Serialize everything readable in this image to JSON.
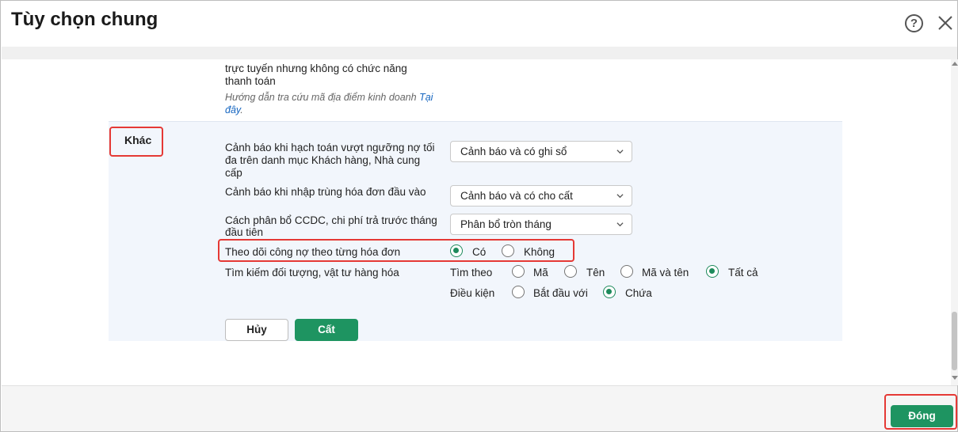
{
  "dialog": {
    "title": "Tùy chọn chung",
    "help_symbol": "?"
  },
  "top_section": {
    "text_line_1": "trực tuyến nhưng không có chức năng",
    "text_line_2": "thanh toán",
    "hint_text": "Hướng dẫn tra cứu mã địa điểm kinh doanh ",
    "hint_link_1": "Tại",
    "hint_link_2": "đây",
    "hint_end": "."
  },
  "khac": {
    "section_label": "Khác",
    "debt_warning": {
      "label_line_1": "Cảnh báo khi hạch toán vượt ngưỡng nợ tối",
      "label_line_2": "đa trên danh mục Khách hàng, Nhà cung",
      "label_line_3": "cấp",
      "value": "Cảnh báo và có ghi sổ"
    },
    "duplicate_invoice": {
      "label": "Cảnh báo khi nhập trùng hóa đơn đầu vào",
      "value": "Cảnh báo và có cho cất"
    },
    "ccdc_allocation": {
      "label_line_1": "Cách phân bổ CCDC, chi phí trả trước tháng",
      "label_line_2": "đầu tiên",
      "value": "Phân bổ tròn tháng"
    },
    "track_debt_by_invoice": {
      "label": "Theo dõi công nợ theo từng hóa đơn",
      "options": [
        "Có",
        "Không"
      ],
      "selected": "Có"
    },
    "search": {
      "label": "Tìm kiếm đối tượng, vật tư hàng hóa",
      "search_by_label": "Tìm theo",
      "search_by_options": [
        "Mã",
        "Tên",
        "Mã và tên",
        "Tất cả"
      ],
      "search_by_selected": "Tất cả",
      "condition_label": "Điều kiện",
      "condition_options": [
        "Bắt đầu với",
        "Chứa"
      ],
      "condition_selected": "Chứa"
    },
    "cancel_label": "Hủy",
    "save_label": "Cất"
  },
  "footer": {
    "close_label": "Đóng"
  },
  "colors": {
    "accent_green": "#1e9461",
    "highlight_red": "#e53935",
    "panel_bg": "#f2f6fc"
  }
}
